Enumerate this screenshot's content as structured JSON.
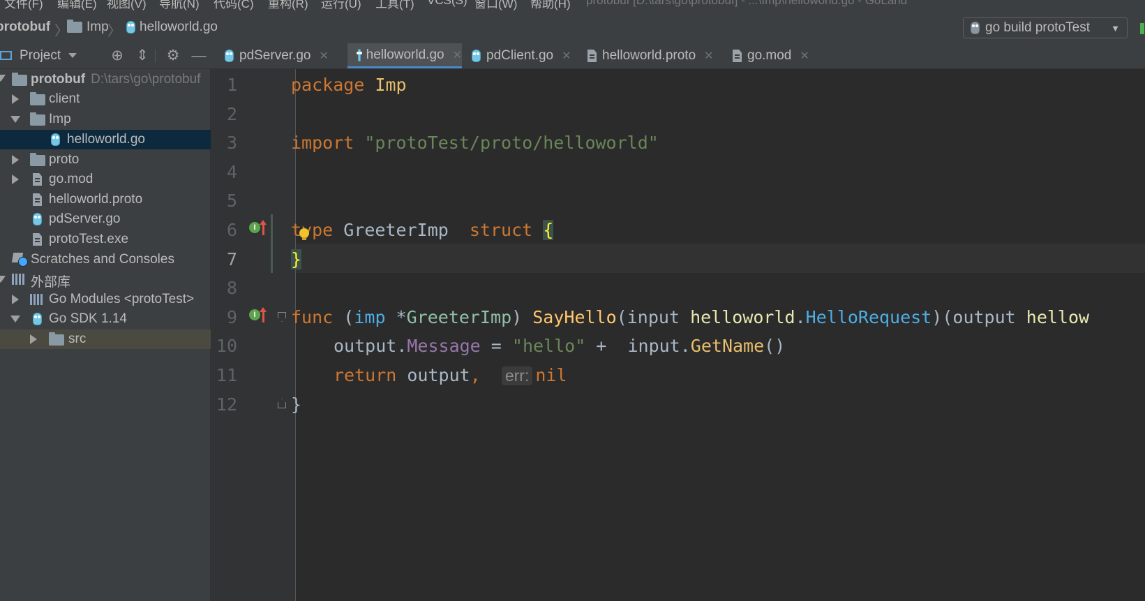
{
  "menu": {
    "items": [
      "文件(F)",
      "编辑(E)",
      "视图(V)",
      "导航(N)",
      "代码(C)",
      "重构(R)",
      "运行(U)",
      "工具(T)",
      "VCS(S)",
      "窗口(W)",
      "帮助(H)"
    ],
    "window_title": "protobuf [D:\\tars\\go\\protobuf] - ...\\Imp\\helloworld.go - GoLand"
  },
  "breadcrumb": {
    "items": [
      "protobuf",
      "Imp",
      "helloworld.go"
    ]
  },
  "run_config": {
    "label": "go build protoTest"
  },
  "project_panel": {
    "title": "Project",
    "tree": [
      {
        "label": "protobuf",
        "path": "D:\\tars\\go\\protobuf",
        "icon": "folder-icon",
        "expanded": true
      },
      {
        "label": "client",
        "icon": "folder-icon",
        "expanded": false
      },
      {
        "label": "Imp",
        "icon": "folder-icon",
        "expanded": true
      },
      {
        "label": "helloworld.go",
        "icon": "go-file-icon",
        "selected": true
      },
      {
        "label": "proto",
        "icon": "folder-icon",
        "expanded": false
      },
      {
        "label": "go.mod",
        "icon": "file-icon",
        "expanded": false
      },
      {
        "label": "helloworld.proto",
        "icon": "file-icon"
      },
      {
        "label": "pdServer.go",
        "icon": "go-file-icon"
      },
      {
        "label": "protoTest.exe",
        "icon": "exe-file-icon"
      },
      {
        "label": "Scratches and Consoles",
        "icon": "scratch-icon"
      },
      {
        "label": "外部库",
        "icon": "library-icon",
        "expanded": true
      },
      {
        "label": "Go Modules <protoTest>",
        "icon": "library-icon",
        "expanded": false
      },
      {
        "label": "Go SDK 1.14",
        "icon": "go-sdk-icon",
        "expanded": true
      },
      {
        "label": "src",
        "icon": "folder-icon",
        "expanded": false
      }
    ]
  },
  "tabs": [
    {
      "label": "pdServer.go",
      "icon": "go-file-icon",
      "active": false
    },
    {
      "label": "helloworld.go",
      "icon": "go-file-icon",
      "active": true
    },
    {
      "label": "pdClient.go",
      "icon": "go-file-icon",
      "active": false
    },
    {
      "label": "helloworld.proto",
      "icon": "file-icon",
      "active": false
    },
    {
      "label": "go.mod",
      "icon": "file-icon",
      "active": false
    }
  ],
  "editor": {
    "line_numbers": [
      "1",
      "2",
      "3",
      "4",
      "5",
      "6",
      "7",
      "8",
      "9",
      "10",
      "11",
      "12"
    ],
    "code": {
      "l1": {
        "kw": "package",
        "name": "Imp"
      },
      "l3": {
        "kw": "import",
        "str": "\"protoTest/proto/helloworld\""
      },
      "l6": {
        "kw": "type",
        "name": "GreeterImp",
        "kw2": "struct",
        "brace": "{"
      },
      "l7": {
        "brace": "}"
      },
      "l9": {
        "kw": "func",
        "open": "(",
        "recv": "imp",
        "star": " *",
        "recv_type": "GreeterImp",
        "close": ")",
        "fn": "SayHello",
        "p_open": "(",
        "p_name": "input",
        "pkg": "helloworld",
        "dot": ".",
        "p_type": "HelloRequest",
        "p_close": ")",
        "r_open": "(",
        "r_name": "output",
        "r_pkg": "hellow"
      },
      "l10": {
        "obj": "output",
        "dot": ".",
        "field": "Message",
        "eq": " = ",
        "str": "\"hello\"",
        "plus": " +  ",
        "obj2": "input",
        "dot2": ".",
        "meth": "GetName",
        "parens": "()"
      },
      "l11": {
        "kw": "return",
        "val": "output",
        "comma": ",",
        "hint": "err:",
        "nil": "nil"
      },
      "l12": {
        "brace": "}"
      }
    }
  }
}
